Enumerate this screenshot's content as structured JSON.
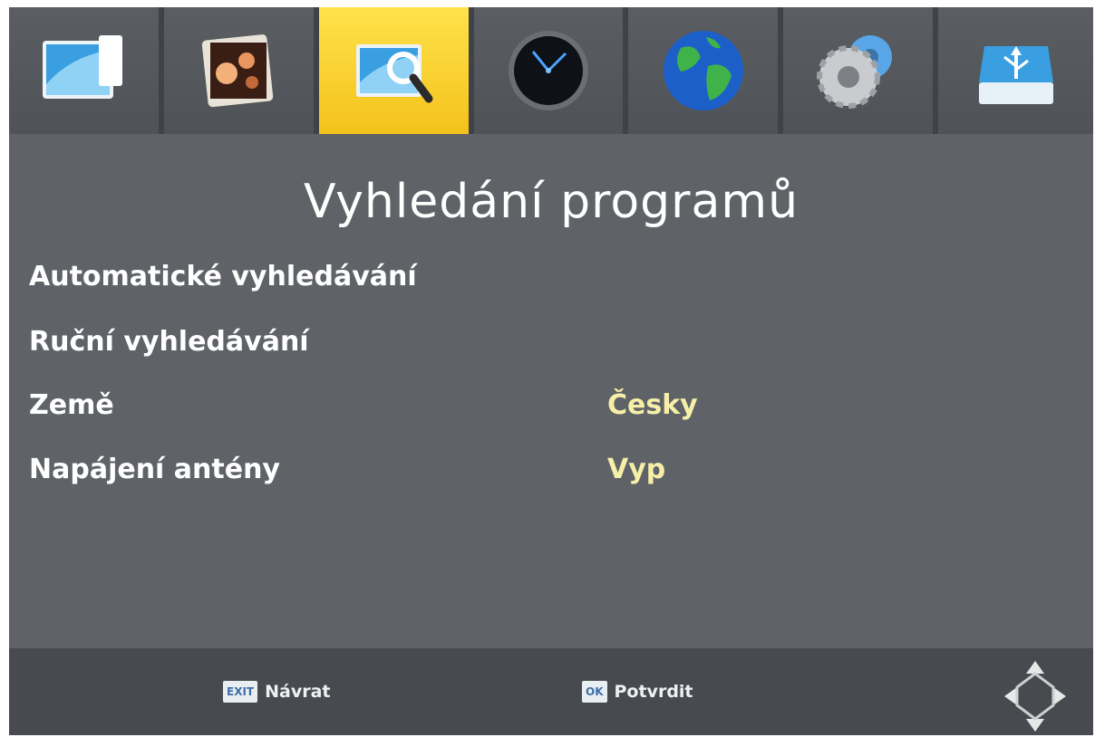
{
  "tabs": [
    {
      "icon": "picture-tv-icon",
      "active": false
    },
    {
      "icon": "photo-album-icon",
      "active": false
    },
    {
      "icon": "channel-search-icon",
      "active": true
    },
    {
      "icon": "clock-icon",
      "active": false
    },
    {
      "icon": "globe-icon",
      "active": false
    },
    {
      "icon": "gears-icon",
      "active": false
    },
    {
      "icon": "usb-drive-icon",
      "active": false
    }
  ],
  "page": {
    "title": "Vyhledání programů"
  },
  "menu": {
    "items": [
      {
        "label": "Automatické vyhledávání",
        "value": ""
      },
      {
        "label": "Ruční vyhledávání",
        "value": ""
      },
      {
        "label": "Země",
        "value": "Česky"
      },
      {
        "label": "Napájení antény",
        "value": "Vyp"
      }
    ]
  },
  "footer": {
    "exit_key": "EXIT",
    "exit_label": "Návrat",
    "ok_key": "OK",
    "ok_label": "Potvrdit"
  },
  "colors": {
    "active_tab": "#f4c21c",
    "background": "#5f6368",
    "value_text": "#f6efa8"
  }
}
